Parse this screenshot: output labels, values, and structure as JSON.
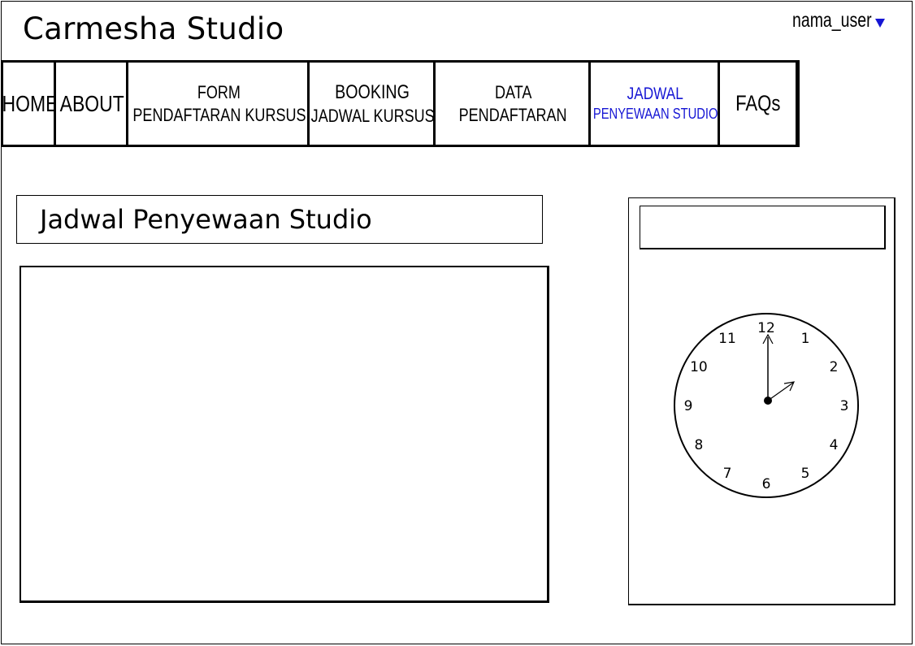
{
  "header": {
    "app_title": "Carmesha Studio",
    "user_name": "nama_user",
    "user_menu_icon": "caret-down-icon"
  },
  "nav": {
    "items": [
      {
        "key": "home",
        "lines": [
          "HOME"
        ],
        "active": false
      },
      {
        "key": "about",
        "lines": [
          "ABOUT"
        ],
        "active": false
      },
      {
        "key": "form",
        "lines": [
          "FORM",
          "PENDAFTARAN KURSUS"
        ],
        "active": false
      },
      {
        "key": "booking",
        "lines": [
          "BOOKING",
          "JADWAL KURSUS"
        ],
        "active": false
      },
      {
        "key": "data",
        "lines": [
          "DATA",
          "PENDAFTARAN"
        ],
        "active": false
      },
      {
        "key": "jadwal",
        "lines": [
          "JADWAL",
          "PENYEWAAN STUDIO"
        ],
        "active": true
      },
      {
        "key": "faqs",
        "lines": [
          "FAQs"
        ],
        "active": false
      }
    ]
  },
  "main": {
    "page_title": "Jadwal Penyewaan Studio"
  },
  "clock": {
    "numbers": [
      "12",
      "1",
      "2",
      "3",
      "4",
      "5",
      "6",
      "7",
      "8",
      "9",
      "10",
      "11"
    ],
    "time": "2:00"
  },
  "colors": {
    "active_nav": "#1515d4",
    "caret": "#1515d4"
  }
}
